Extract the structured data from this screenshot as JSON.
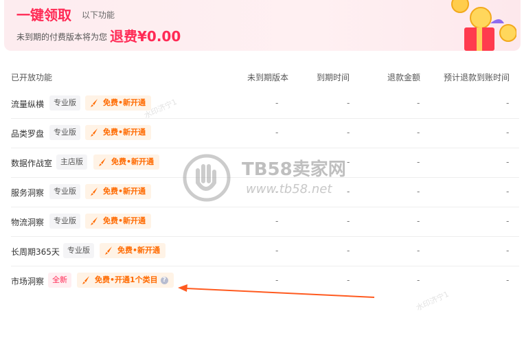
{
  "banner": {
    "title": "一键领取",
    "subtitle": "以下功能",
    "line_text": "未到期的付费版本将为您",
    "refund_text": "退费¥0.00"
  },
  "table": {
    "headers": [
      "已开放功能",
      "未到期版本",
      "到期时间",
      "退款金额",
      "预计退款到账时间"
    ],
    "rows": [
      {
        "name": "流量纵横",
        "tag": "专业版",
        "cta": "免费•新开通",
        "cells": [
          "-",
          "-",
          "-",
          "-"
        ]
      },
      {
        "name": "品类罗盘",
        "tag": "专业版",
        "cta": "免费•新开通",
        "cells": [
          "-",
          "-",
          "-",
          "-"
        ]
      },
      {
        "name": "数据作战室",
        "tag": "主店版",
        "cta": "免费•新开通",
        "cells": [
          "-",
          "-",
          "-",
          "-"
        ]
      },
      {
        "name": "服务洞察",
        "tag": "专业版",
        "cta": "免费•新开通",
        "cells": [
          "-",
          "-",
          "-",
          "-"
        ]
      },
      {
        "name": "物流洞察",
        "tag": "专业版",
        "cta": "免费•新开通",
        "cells": [
          "-",
          "-",
          "-",
          "-"
        ]
      },
      {
        "name": "长周期365天",
        "tag": "专业版",
        "cta": "免费•新开通",
        "cells": [
          "-",
          "-",
          "-",
          "-"
        ]
      },
      {
        "name": "市场洞察",
        "tag": "全新",
        "cta": "免费•开通1个类目",
        "cells": [
          "-",
          "-",
          "-",
          "-"
        ]
      }
    ]
  },
  "watermark": {
    "site_name": "TB58卖家网",
    "url": "www.tb58.net",
    "small_text": "水印济宁1"
  },
  "colors": {
    "accent": "#ff2a55",
    "cta_text": "#ff6a00",
    "cta_bg": "#fff3e6",
    "arrow": "#ff5a1f"
  }
}
